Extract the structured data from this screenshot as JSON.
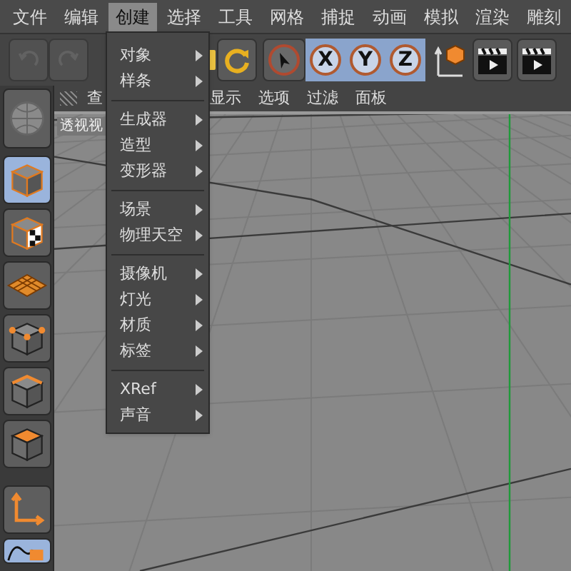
{
  "menu_bar": [
    {
      "label": "文件",
      "selected": false
    },
    {
      "label": "编辑",
      "selected": false
    },
    {
      "label": "创建",
      "selected": true
    },
    {
      "label": "选择",
      "selected": false
    },
    {
      "label": "工具",
      "selected": false
    },
    {
      "label": "网格",
      "selected": false
    },
    {
      "label": "捕捉",
      "selected": false
    },
    {
      "label": "动画",
      "selected": false
    },
    {
      "label": "模拟",
      "selected": false
    },
    {
      "label": "渲染",
      "selected": false
    },
    {
      "label": "雕刻",
      "selected": false
    }
  ],
  "toolbar": [
    {
      "kind": "undo",
      "disabled": true
    },
    {
      "kind": "redo",
      "disabled": true
    },
    {
      "kind": "object"
    },
    {
      "kind": "rotate"
    },
    {
      "kind": "select"
    },
    {
      "kind": "axis",
      "label": "X",
      "on": true
    },
    {
      "kind": "axis",
      "label": "Y",
      "on": true
    },
    {
      "kind": "axis",
      "label": "Z",
      "on": true
    },
    {
      "kind": "coords"
    },
    {
      "kind": "render"
    },
    {
      "kind": "render"
    }
  ],
  "left_toolbar": [
    {
      "kind": "editable",
      "selected": false
    },
    {
      "kind": "model",
      "selected": true
    },
    {
      "kind": "texture",
      "selected": false
    },
    {
      "kind": "workplane",
      "selected": false
    },
    {
      "kind": "points",
      "selected": false
    },
    {
      "kind": "edges",
      "selected": false
    },
    {
      "kind": "polygons",
      "selected": false
    },
    {
      "kind": "axis",
      "selected": false
    },
    {
      "kind": "spline",
      "selected": true
    }
  ],
  "viewport": {
    "menu": [
      "查",
      "显示",
      "选项",
      "过滤",
      "面板"
    ],
    "label": "透视视"
  },
  "dropdown": [
    [
      {
        "label": "对象",
        "submenu": true
      },
      {
        "label": "样条",
        "submenu": true
      }
    ],
    [
      {
        "label": "生成器",
        "submenu": true
      },
      {
        "label": "造型",
        "submenu": true
      },
      {
        "label": "变形器",
        "submenu": true
      }
    ],
    [
      {
        "label": "场景",
        "submenu": true
      },
      {
        "label": "物理天空",
        "submenu": true
      }
    ],
    [
      {
        "label": "摄像机",
        "submenu": true
      },
      {
        "label": "灯光",
        "submenu": true
      },
      {
        "label": "材质",
        "submenu": true
      },
      {
        "label": "标签",
        "submenu": true
      }
    ],
    [
      {
        "label": "XRef",
        "submenu": true
      },
      {
        "label": "声音",
        "submenu": true
      }
    ]
  ]
}
